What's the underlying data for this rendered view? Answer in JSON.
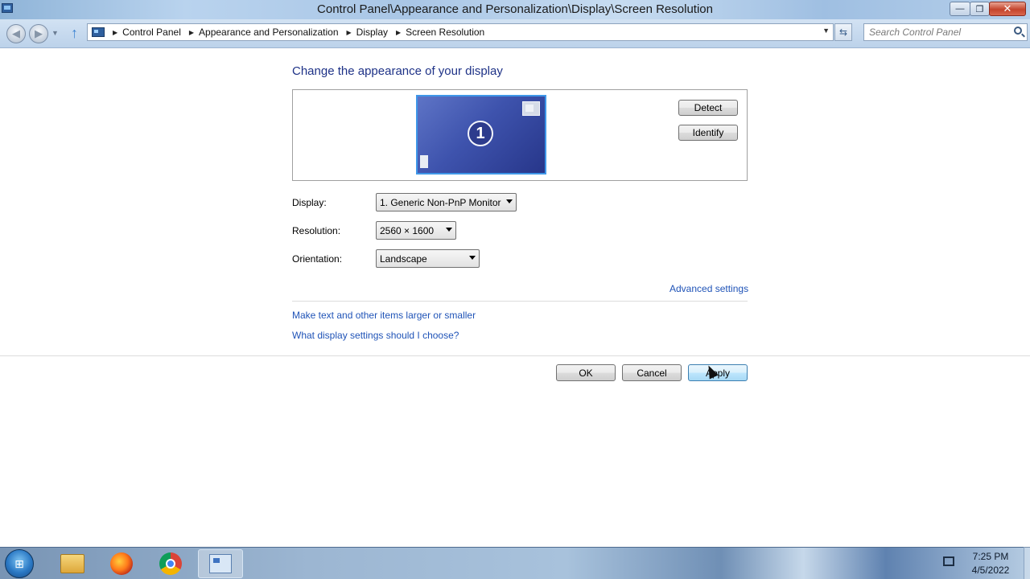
{
  "window": {
    "title": "Control Panel\\Appearance and Personalization\\Display\\Screen Resolution",
    "minimize_glyph": "—",
    "maximize_glyph": "❐",
    "close_glyph": "✕"
  },
  "address_bar": {
    "breadcrumbs": [
      "Control Panel",
      "Appearance and Personalization",
      "Display",
      "Screen Resolution"
    ],
    "search_placeholder": "Search Control Panel"
  },
  "content": {
    "title": "Change the appearance of your display",
    "monitor_number": "1",
    "detect_label": "Detect",
    "identify_label": "Identify",
    "display_label": "Display:",
    "display_value": "1. Generic Non-PnP Monitor",
    "resolution_label": "Resolution:",
    "resolution_value": "2560 × 1600",
    "orientation_label": "Orientation:",
    "orientation_value": "Landscape",
    "advanced_settings": "Advanced settings",
    "link_text_size": "Make text and other items larger or smaller",
    "link_which_settings": "What display settings should I choose?",
    "ok_label": "OK",
    "cancel_label": "Cancel",
    "apply_label": "Apply"
  },
  "taskbar": {
    "time": "7:25 PM",
    "date": "4/5/2022",
    "items": [
      "windows-explorer",
      "firefox",
      "chrome",
      "control-panel"
    ]
  },
  "colors": {
    "link": "#1f53b7",
    "title": "#1e3287",
    "monitor_border": "#3f97e8"
  }
}
